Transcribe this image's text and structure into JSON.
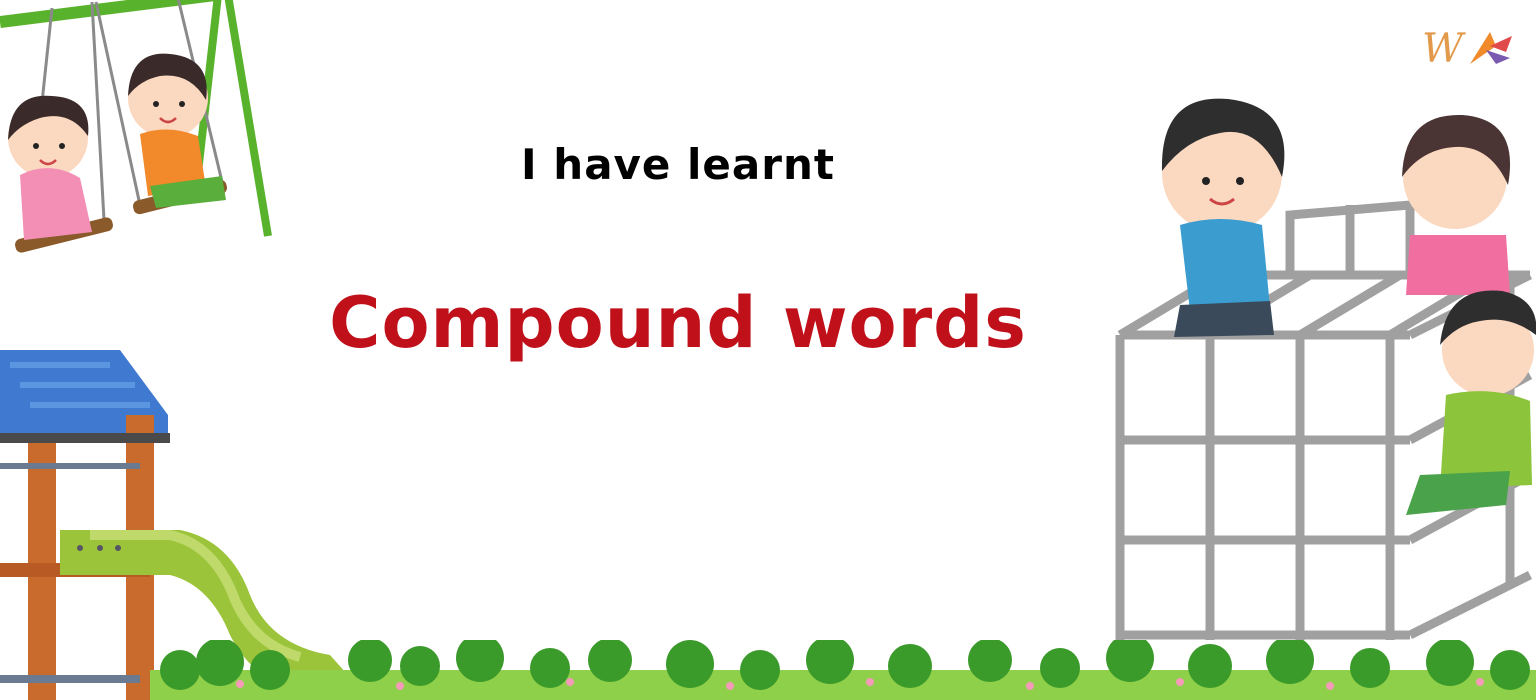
{
  "slide": {
    "subtitle": "I have learnt",
    "title": "Compound words"
  },
  "logo": {
    "letter": "W"
  },
  "colors": {
    "title": "#c0101a",
    "subtitle": "#000000",
    "grass": "#4bb32e",
    "swing_frame": "#58b22b",
    "slide": "#9cc43b",
    "roof": "#3f7ad0",
    "jungle_gym": "#a0a0a0"
  },
  "illustrations": [
    "swing-set-illustration",
    "playhouse-slide-illustration",
    "jungle-gym-illustration",
    "grass-border-illustration"
  ]
}
